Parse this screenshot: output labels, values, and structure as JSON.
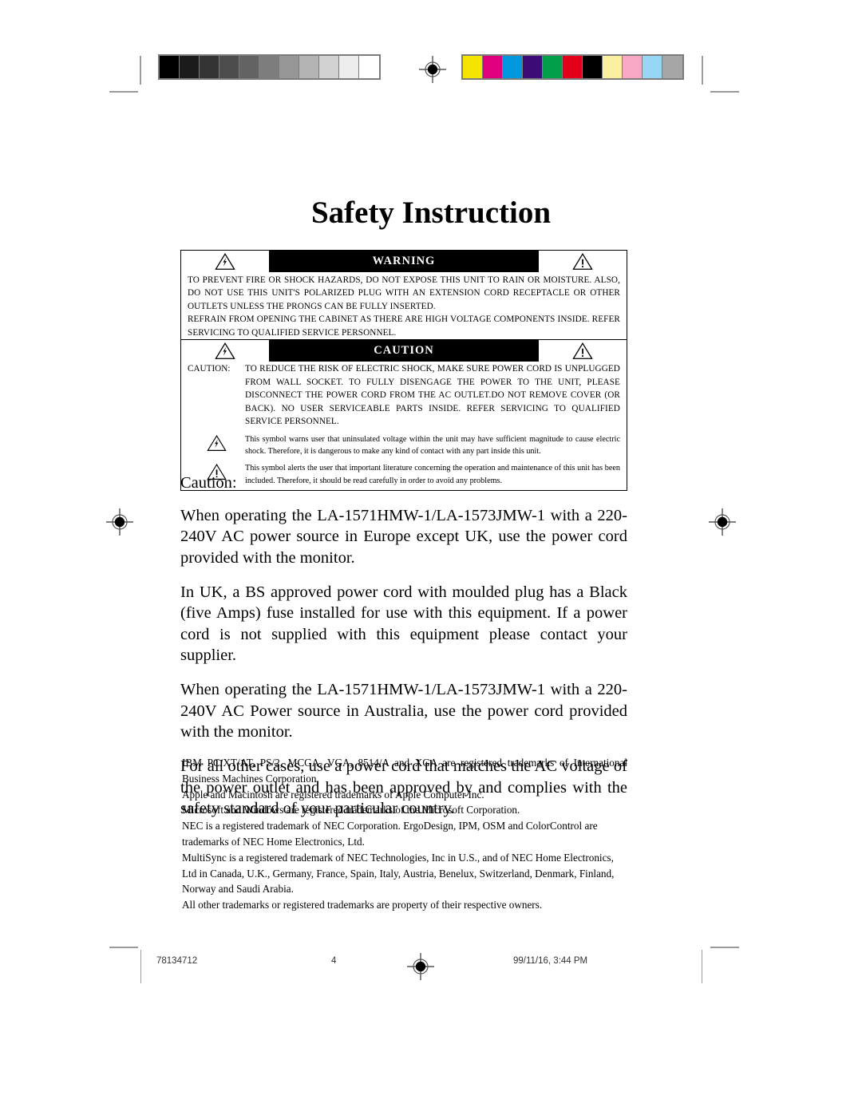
{
  "page": {
    "title": "Safety Instruction"
  },
  "calibration": {
    "grayscale_label": "grayscale-calibration-strip",
    "color_label": "color-calibration-strip",
    "grayscale_swatches": [
      "#000000",
      "#1b1b1b",
      "#333333",
      "#4d4d4d",
      "#636363",
      "#7d7d7d",
      "#969696",
      "#b4b4b4",
      "#d2d2d2",
      "#ededed",
      "#ffffff"
    ],
    "color_swatches": [
      "#f5e400",
      "#e0007d",
      "#0098dd",
      "#3d0b76",
      "#00a04a",
      "#e2001a",
      "#000000",
      "#faf0a0",
      "#f8a8c4",
      "#97d6f5",
      "#a6a6a6"
    ]
  },
  "warning": {
    "heading": "WARNING",
    "left_symbol": "lightning-bolt-triangle-icon",
    "right_symbol": "exclamation-triangle-icon",
    "paragraphs": [
      "TO PREVENT FIRE OR SHOCK HAZARDS, DO NOT EXPOSE THIS UNIT TO RAIN OR MOISTURE. ALSO, DO NOT USE THIS UNIT'S POLARIZED PLUG WITH AN EXTENSION CORD RECEPTACLE OR OTHER OUTLETS UNLESS THE PRONGS CAN BE FULLY INSERTED.",
      "REFRAIN FROM OPENING THE CABINET AS THERE ARE HIGH VOLTAGE COMPONENTS INSIDE. REFER SERVICING TO QUALIFIED SERVICE PERSONNEL."
    ]
  },
  "caution_box": {
    "heading": "CAUTION",
    "left_symbol": "lightning-bolt-triangle-icon",
    "right_symbol": "exclamation-triangle-icon",
    "label": "CAUTION:",
    "body": "TO REDUCE THE RISK OF ELECTRIC SHOCK, MAKE SURE POWER CORD IS UNPLUGGED FROM WALL SOCKET. TO FULLY DISENGAGE THE POWER TO THE UNIT, PLEASE DISCONNECT THE POWER CORD FROM THE AC OUTLET.DO NOT REMOVE COVER (OR BACK). NO USER SERVICEABLE PARTS INSIDE. REFER SERVICING TO QUALIFIED SERVICE PERSONNEL.",
    "symbol_notes": [
      {
        "symbol": "lightning-bolt-triangle-icon",
        "text": "This symbol warns user that uninsulated voltage within the unit may have sufficient magnitude to cause electric shock. Therefore, it is dangerous to make any kind of contact with any part inside this unit."
      },
      {
        "symbol": "exclamation-triangle-icon",
        "text": "This symbol alerts the user that important literature concerning the operation and maintenance of this unit has been included. Therefore, it should be read carefully in order to avoid any problems."
      }
    ]
  },
  "body": {
    "lead": "Caution:",
    "paragraphs": [
      "When operating the LA-1571HMW-1/LA-1573JMW-1 with a 220-240V AC power source in Europe except UK, use the power cord provided with the monitor.",
      "In UK, a BS approved power cord with moulded plug has a Black (five Amps) fuse installed for use with this equipment. If a power cord is not supplied with this equipment please contact your supplier.",
      "When operating the LA-1571HMW-1/LA-1573JMW-1 with a 220-240V AC Power source in Australia, use the power cord provided with the monitor.",
      "For all other cases, use a power cord that matches the AC voltage of the power outlet and has been approved by and complies with the safety standard of your particular country."
    ]
  },
  "trademarks": [
    "IBM PC/XT/AT, PS/2, MCGA, VGA, 8514/A and XGA are registered trademarks of International Business Machines Corporation.",
    "Apple and Macintosh are registered trademarks of Apple Computer Inc.",
    "Microsoft and Windows are registered trademarks of the Microsoft Corporation.",
    "NEC is a registered trademark of NEC Corporation. ErgoDesign, IPM, OSM and ColorControl are trademarks of NEC Home Electronics, Ltd.",
    "MultiSync is a registered trademark of NEC Technologies, Inc in U.S., and of NEC Home Electronics, Ltd in Canada, U.K., Germany, France, Spain, Italy, Austria, Benelux, Switzerland, Denmark, Finland, Norway and Saudi Arabia.",
    "All other trademarks or registered trademarks are property of their respective owners."
  ],
  "footer": {
    "document_number": "78134712",
    "page_number": "4",
    "timestamp": "99/11/16, 3:44 PM"
  }
}
